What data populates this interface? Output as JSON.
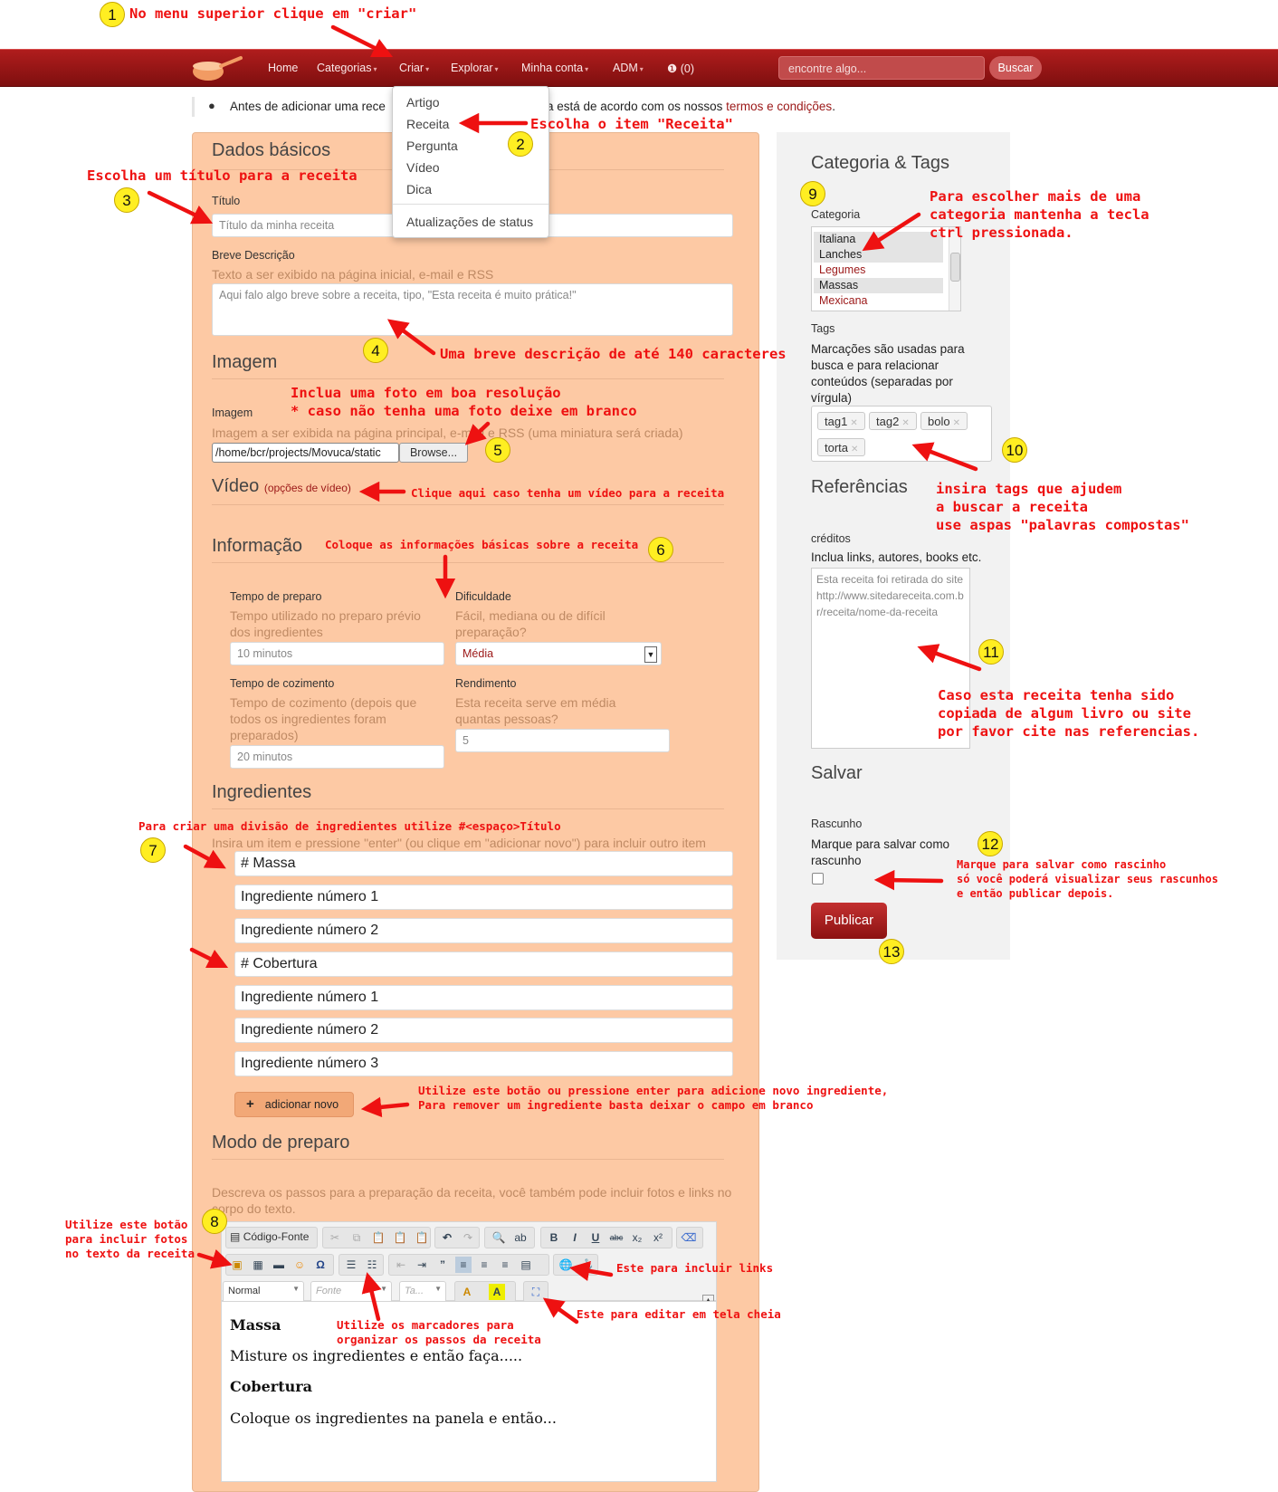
{
  "annotations": {
    "a1": "No menu superior clique em \"criar\"",
    "a2": "Escolha o item \"Receita\"",
    "a3": "Escolha um título para a receita",
    "a4": "Uma breve descrição de até 140 caracteres",
    "a5_line1": "Inclua uma foto em boa resolução",
    "a5_line2": "* caso não tenha uma foto deixe em branco",
    "a_video": "Clique aqui caso tenha um vídeo para a receita",
    "a6": "Coloque as informações básicas sobre a receita",
    "a7": "Para criar uma divisão de ingredientes utilize #<espaço>Título",
    "a_add_line1": "Utilize este botão ou pressione enter para adicione novo ingrediente,",
    "a_add_line2": "Para remover um ingrediente basta deixar o campo em branco",
    "a8_line1": "Utilize este botão",
    "a8_line2": "para incluir fotos",
    "a8_line3": "no texto da receita",
    "a_links": "Este para incluir links",
    "a_fullscreen": "Este para editar em tela cheia",
    "a_markers_line1": "Utilize os marcadores para",
    "a_markers_line2": "organizar os passos da receita",
    "a9_line1": "Para escolher mais de uma",
    "a9_line2": "categoria mantenha a tecla",
    "a9_line3": "ctrl pressionada.",
    "a10_line1": "insira tags que ajudem",
    "a10_line2": "a buscar a receita",
    "a10_line3": "use aspas \"palavras compostas\"",
    "a11_line1": "Caso esta receita tenha sido",
    "a11_line2": "copiada de algum livro ou site",
    "a11_line3": "por favor cite nas referencias.",
    "a12_line1": "Marque para salvar como rascinho",
    "a12_line2": "só você poderá visualizar seus rascunhos",
    "a12_line3": "e então publicar depois.",
    "numbers": [
      "1",
      "2",
      "3",
      "4",
      "5",
      "6",
      "7",
      "8",
      "9",
      "10",
      "11",
      "12",
      "13"
    ]
  },
  "nav": {
    "items": [
      "Home",
      "Categorias",
      "Criar",
      "Explorar",
      "Minha conta",
      "ADM"
    ],
    "notifications": "(0)",
    "search_placeholder": "encontre algo...",
    "search_button": "Buscar"
  },
  "dropdown": {
    "items": [
      "Artigo",
      "Receita",
      "Pergunta",
      "Vídeo",
      "Dica"
    ],
    "extra": "Atualizações de status"
  },
  "notice": {
    "prefix": "Antes de adicionar uma rece",
    "suffix": "a está de acordo com os nossos ",
    "link": "termos e condições",
    "end": "."
  },
  "form": {
    "basic_title": "Dados básicos",
    "title_label": "Título",
    "title_placeholder": "Título da minha receita",
    "desc_label": "Breve Descrição",
    "desc_help": "Texto a ser exibido na página inicial, e-mail e RSS",
    "desc_placeholder": "Aqui falo algo breve sobre a receita, tipo, \"Esta receita é muito prática!\"",
    "image_title": "Imagem",
    "image_label": "Imagem",
    "image_help": "Imagem a ser exibida na página principal, e-mail e RSS (uma miniatura será criada)",
    "image_path": "/home/bcr/projects/Movuca/static",
    "browse": "Browse...",
    "video_title": "Vídeo",
    "video_options": "(opções de vídeo)",
    "info_title": "Informação",
    "prep_label": "Tempo de preparo",
    "prep_help": "Tempo utilizado no preparo prévio dos ingredientes",
    "prep_value": "10 minutos",
    "diff_label": "Dificuldade",
    "diff_help": "Fácil, mediana ou de difícil preparação?",
    "diff_value": "Média",
    "cook_label": "Tempo de cozimento",
    "cook_help": "Tempo de cozimento (depois que todos os ingredientes foram preparados)",
    "cook_value": "20 minutos",
    "yield_label": "Rendimento",
    "yield_help": "Esta receita serve em média quantas pessoas?",
    "yield_value": "5",
    "ingredients_title": "Ingredientes",
    "ingredients_help": "Insira um item e pressione \"enter\" (ou clique em \"adicionar novo\") para incluir outro item",
    "ingredients": [
      "# Massa",
      "Ingrediente número 1",
      "Ingrediente número 2",
      "# Cobertura",
      "Ingrediente número 1",
      "Ingrediente número 2",
      "Ingrediente número 3"
    ],
    "add_button": "adicionar novo",
    "method_title": "Modo de preparo",
    "method_help": "Descreva os passos para a preparação da receita, você também pode incluir fotos e links no corpo do texto.",
    "source_button": "Código-Fonte",
    "format_select": "Normal",
    "font_select": "Fonte",
    "size_select": "Ta...",
    "editor": {
      "h1": "Massa",
      "p1": "Misture os ingredientes e então faça.....",
      "h2": "Cobertura",
      "p2": "Coloque os ingredientes na panela e então..."
    }
  },
  "sidebar": {
    "cat_title": "Categoria & Tags",
    "cat_label": "Categoria",
    "categories": [
      "Italiana",
      "Lanches",
      "Legumes",
      "Massas",
      "Mexicana"
    ],
    "tags_label": "Tags",
    "tags_help": "Marcações são usadas para busca e para relacionar conteúdos (separadas por vírgula)",
    "tags": [
      "tag1",
      "tag2",
      "bolo",
      "torta"
    ],
    "ref_title": "Referências",
    "credits_label": "créditos",
    "credits_help": "Inclua links, autores, books etc.",
    "credits_text": "Esta receita foi retirada do site http://www.sitedareceita.com.br/receita/nome-da-receita",
    "save_title": "Salvar",
    "draft_label": "Rascunho",
    "draft_help": "Marque para salvar como rascunho",
    "publish": "Publicar"
  },
  "colors": {
    "brand": "#9b1717",
    "annotation": "#ee1111",
    "panel": "#fdc9a4",
    "highlight": "#ffee22"
  }
}
